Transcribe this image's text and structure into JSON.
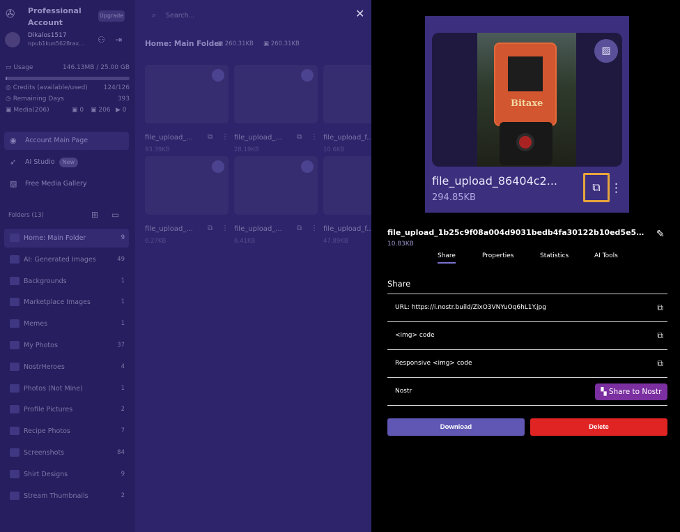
{
  "account": {
    "title": "Professional Account",
    "upgrade_label": "Upgrade",
    "username": "Dikalos1517",
    "pubkey": "npub1kun5628rax..."
  },
  "usage": {
    "label": "Usage",
    "value": "146.13MB / 25.00 GB",
    "fraction": 0.006,
    "credits_label": "Credits (available/used)",
    "credits_value": "124/126",
    "days_label": "Remaining Days",
    "days_value": "393",
    "media_label": "Media(206)",
    "media_counts": [
      "0",
      "206",
      "0"
    ]
  },
  "nav": [
    {
      "label": "Account Main Page",
      "icon": "user-icon"
    },
    {
      "label": "AI Studio",
      "badge": "New",
      "icon": "rocket-icon"
    },
    {
      "label": "Free Media Gallery",
      "icon": "image-icon"
    }
  ],
  "folders": {
    "header": "Folders (13)",
    "items": [
      {
        "name": "Home: Main Folder",
        "count": "9"
      },
      {
        "name": "AI: Generated Images",
        "count": "49"
      },
      {
        "name": "Backgrounds",
        "count": "1"
      },
      {
        "name": "Marketplace Images",
        "count": "1"
      },
      {
        "name": "Memes",
        "count": "1"
      },
      {
        "name": "My Photos",
        "count": "37"
      },
      {
        "name": "NostrHeroes",
        "count": "4"
      },
      {
        "name": "Photos (Not Mine)",
        "count": "1"
      },
      {
        "name": "Profile Pictures",
        "count": "2"
      },
      {
        "name": "Recipe Photos",
        "count": "7"
      },
      {
        "name": "Screenshots",
        "count": "84"
      },
      {
        "name": "Shirt Designs",
        "count": "9"
      },
      {
        "name": "Stream Thumbnails",
        "count": "2"
      }
    ]
  },
  "main": {
    "search_placeholder": "Search...",
    "breadcrumb": "Home: Main Folder",
    "sizes": [
      "260.31KB",
      "260.31KB"
    ],
    "thumbs": [
      {
        "name": "file_upload_...",
        "size": "93.39KB"
      },
      {
        "name": "file_upload_...",
        "size": "28.19KB"
      },
      {
        "name": "file_upload_f...",
        "size": "10.6KB"
      },
      {
        "name": "file_upload_...",
        "size": "6.27KB"
      },
      {
        "name": "file_upload_...",
        "size": "6.41KB"
      },
      {
        "name": "file_upload_f...",
        "size": "47.89KB"
      }
    ]
  },
  "preview": {
    "name": "file_upload_86404c2...",
    "size": "294.85KB",
    "image_text": "Bitaxe"
  },
  "detail": {
    "file_name": "file_upload_1b25c9f08a004d9031bedb4fa30122b10ed5e5fbff181e...",
    "file_size": "10.83KB",
    "tabs": [
      "Share",
      "Properties",
      "Statistics",
      "AI Tools"
    ],
    "share_title": "Share",
    "rows": [
      {
        "label": "URL: https://i.nostr.build/ZixO3VNYuOq6hL1Y.jpg"
      },
      {
        "label": "<img> code"
      },
      {
        "label": "Responsive <img> code"
      },
      {
        "label": "Nostr",
        "button": "Share to Nostr"
      }
    ],
    "download_label": "Download",
    "delete_label": "Delete"
  },
  "colors": {
    "overlay_bg": "#2d246b",
    "accent": "#5f57b3",
    "danger": "#e02424",
    "nostr": "#7b2fa0",
    "highlight": "#e8a53c"
  }
}
